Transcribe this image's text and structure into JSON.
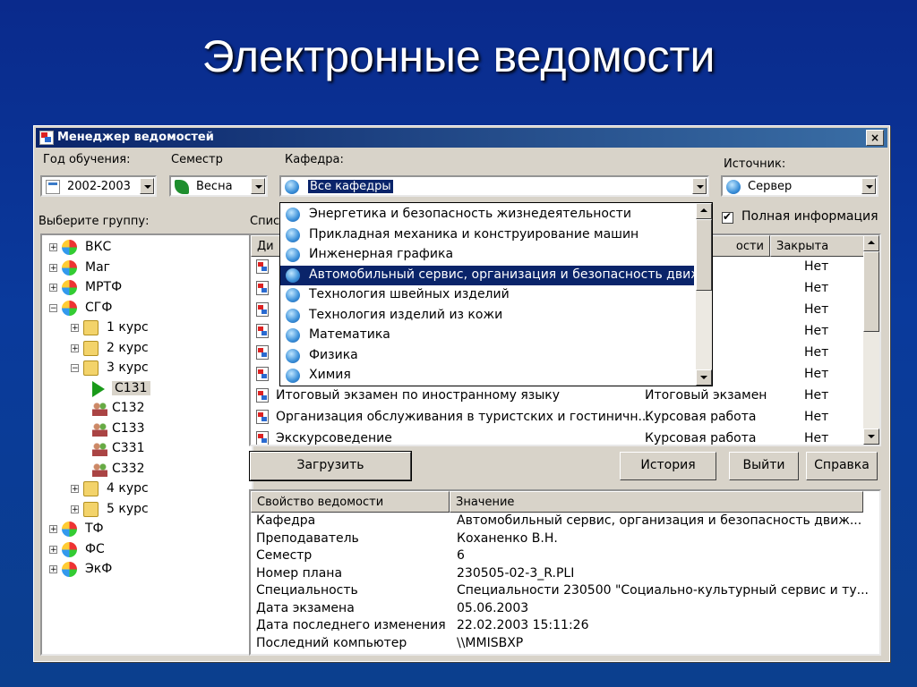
{
  "slide": {
    "title": "Электронные ведомости"
  },
  "window": {
    "title": "Менеджер ведомостей",
    "close": "×"
  },
  "filters": {
    "year_label": "Год обучения:",
    "year_value": "2002-2003",
    "semester_label": "Семестр",
    "semester_value": "Весна",
    "department_label": "Кафедра:",
    "department_value": "Все кафедры",
    "source_label": "Источник:",
    "source_value": "Сервер",
    "full_info_label": "Полная информация"
  },
  "tree": {
    "label": "Выберите группу:",
    "items": [
      {
        "text": "ВКС",
        "level": 0,
        "expander": "+",
        "icon": "faculty-icon"
      },
      {
        "text": "Маг",
        "level": 0,
        "expander": "+",
        "icon": "faculty-icon"
      },
      {
        "text": "МРТФ",
        "level": 0,
        "expander": "+",
        "icon": "faculty-icon"
      },
      {
        "text": "СГФ",
        "level": 0,
        "expander": "−",
        "icon": "faculty-icon"
      },
      {
        "text": "1 курс",
        "level": 1,
        "expander": "+",
        "icon": "folder-icon"
      },
      {
        "text": "2 курс",
        "level": 1,
        "expander": "+",
        "icon": "folder-icon"
      },
      {
        "text": "3 курс",
        "level": 1,
        "expander": "−",
        "icon": "folder-icon"
      },
      {
        "text": "С131",
        "level": 2,
        "expander": "",
        "icon": "play-icon",
        "selected": true
      },
      {
        "text": "С132",
        "level": 2,
        "expander": "",
        "icon": "group-icon"
      },
      {
        "text": "С133",
        "level": 2,
        "expander": "",
        "icon": "group-icon"
      },
      {
        "text": "С331",
        "level": 2,
        "expander": "",
        "icon": "group-icon"
      },
      {
        "text": "С332",
        "level": 2,
        "expander": "",
        "icon": "group-icon"
      },
      {
        "text": "4 курс",
        "level": 1,
        "expander": "+",
        "icon": "folder-icon"
      },
      {
        "text": "5 курс",
        "level": 1,
        "expander": "+",
        "icon": "folder-icon"
      },
      {
        "text": "ТФ",
        "level": 0,
        "expander": "+",
        "icon": "faculty-icon"
      },
      {
        "text": "ФС",
        "level": 0,
        "expander": "+",
        "icon": "faculty-icon"
      },
      {
        "text": "ЭкФ",
        "level": 0,
        "expander": "+",
        "icon": "faculty-icon"
      }
    ]
  },
  "list": {
    "label": "Спис",
    "headers": {
      "col1": "Ди",
      "col2": "ости",
      "col3": "Закрыта"
    },
    "rows": [
      {
        "name": "",
        "type": "",
        "closed": "Нет"
      },
      {
        "name": "",
        "type": "",
        "closed": "Нет"
      },
      {
        "name": "",
        "type": "",
        "closed": "Нет"
      },
      {
        "name": "",
        "type": "",
        "closed": "Нет"
      },
      {
        "name": "",
        "type": "",
        "closed": "Нет"
      },
      {
        "name": "",
        "type": "",
        "closed": "Нет"
      },
      {
        "name": "Итоговый экзамен по иностранному языку",
        "type": "Итоговый экзамен",
        "closed": "Нет"
      },
      {
        "name": "Организация обслуживания в туристских и гостиничн...",
        "type": "Курсовая работа",
        "closed": "Нет"
      },
      {
        "name": "Экскурсоведение",
        "type": "Курсовая работа",
        "closed": "Нет"
      }
    ]
  },
  "dropdown": {
    "items": [
      {
        "text": "Энергетика и безопасность жизнедеятельности"
      },
      {
        "text": "Прикладная механика и конструирование машин"
      },
      {
        "text": "Инженерная графика"
      },
      {
        "text": "Автомобильный сервис, организация и безопасность движ",
        "selected": true
      },
      {
        "text": "Технология швейных изделий"
      },
      {
        "text": "Технология изделий из кожи"
      },
      {
        "text": "Математика"
      },
      {
        "text": "Физика"
      },
      {
        "text": "Химия"
      }
    ]
  },
  "buttons": {
    "load": "Загрузить",
    "history": "История",
    "exit": "Выйти",
    "help": "Справка"
  },
  "properties": {
    "header_key": "Свойство ведомости",
    "header_value": "Значение",
    "rows": [
      {
        "key": "Кафедра",
        "value": "Автомобильный сервис, организация и безопасность движ..."
      },
      {
        "key": "Преподаватель",
        "value": "Коханенко В.Н."
      },
      {
        "key": "Семестр",
        "value": "6"
      },
      {
        "key": "Номер плана",
        "value": "230505-02-3_R.PLI"
      },
      {
        "key": "Специальность",
        "value": "Специальности 230500 \"Социально-культурный сервис и ту..."
      },
      {
        "key": "Дата экзамена",
        "value": "05.06.2003"
      },
      {
        "key": "Дата последнего изменения",
        "value": "22.02.2003 15:11:26"
      },
      {
        "key": "Последний компьютер",
        "value": "\\\\MMISBXP"
      }
    ]
  }
}
